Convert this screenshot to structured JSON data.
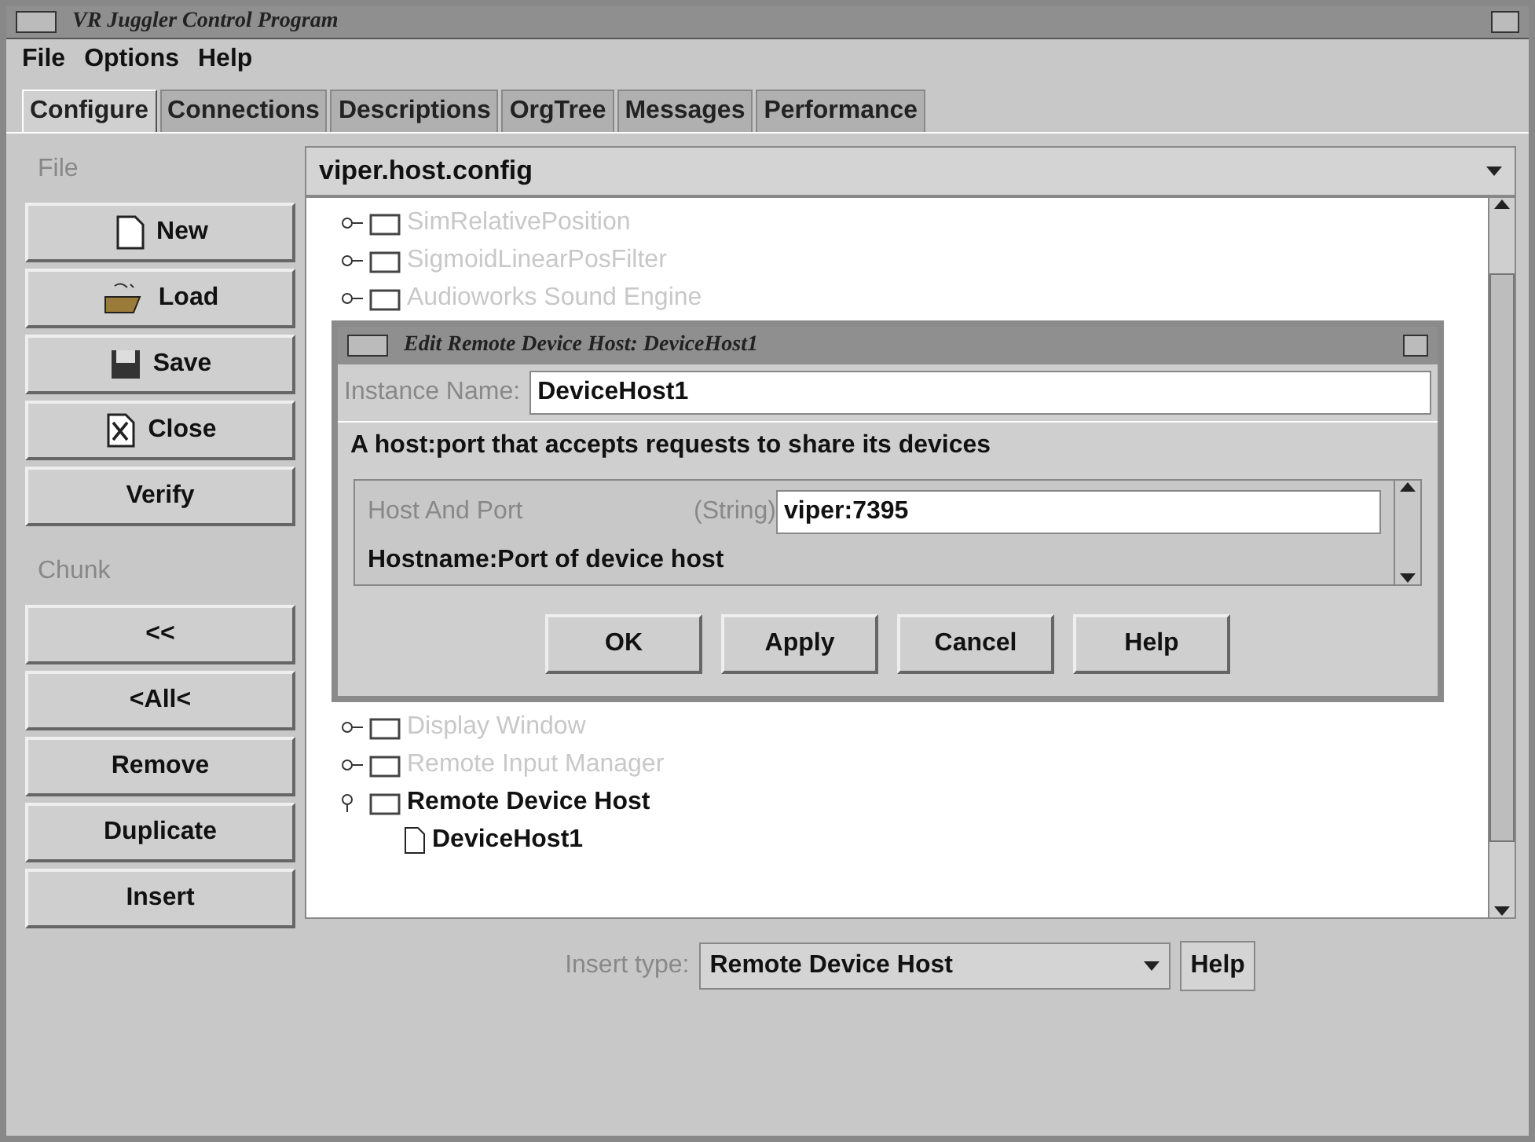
{
  "window": {
    "title": "VR Juggler Control Program"
  },
  "menu": [
    "File",
    "Options",
    "Help"
  ],
  "tabs": [
    {
      "label": "Configure",
      "selected": true
    },
    {
      "label": "Connections",
      "selected": false
    },
    {
      "label": "Descriptions",
      "selected": false
    },
    {
      "label": "OrgTree",
      "selected": false
    },
    {
      "label": "Messages",
      "selected": false
    },
    {
      "label": "Performance",
      "selected": false
    }
  ],
  "sidebar": {
    "file_label": "File",
    "file_buttons": [
      {
        "label": "New",
        "kind": "new"
      },
      {
        "label": "Load",
        "kind": "load"
      },
      {
        "label": "Save",
        "kind": "save"
      },
      {
        "label": "Close",
        "kind": "close"
      },
      {
        "label": "Verify",
        "kind": "plain"
      }
    ],
    "chunk_label": "Chunk",
    "chunk_buttons": [
      {
        "label": "<<",
        "kind": "plain"
      },
      {
        "label": "<All<",
        "kind": "plain"
      },
      {
        "label": "Remove",
        "kind": "plain"
      },
      {
        "label": "Duplicate",
        "kind": "plain"
      },
      {
        "label": "Insert",
        "kind": "plain"
      }
    ]
  },
  "config_file": "viper.host.config",
  "tree": [
    {
      "label": "SimRelativePosition",
      "disabled": true,
      "expanded": false
    },
    {
      "label": "SigmoidLinearPosFilter",
      "disabled": true,
      "expanded": false
    },
    {
      "label": "Audioworks Sound Engine",
      "disabled": true,
      "expanded": false
    },
    {
      "label": "Display Window",
      "disabled": true,
      "expanded": false
    },
    {
      "label": "Remote Input Manager",
      "disabled": true,
      "expanded": false
    },
    {
      "label": "Remote Device Host",
      "disabled": false,
      "expanded": true,
      "children": [
        {
          "label": "DeviceHost1",
          "disabled": false
        }
      ]
    }
  ],
  "dialog": {
    "title": "Edit Remote Device Host: DeviceHost1",
    "instance_label": "Instance Name:",
    "instance_value": "DeviceHost1",
    "description": "A host:port that accepts requests to share its devices",
    "property": {
      "name": "Host And Port",
      "type": "(String)",
      "value": "viper:7395",
      "help": "Hostname:Port of device host"
    },
    "buttons": [
      "OK",
      "Apply",
      "Cancel",
      "Help"
    ]
  },
  "insert": {
    "label": "Insert type:",
    "value": "Remote Device Host",
    "help": "Help"
  }
}
